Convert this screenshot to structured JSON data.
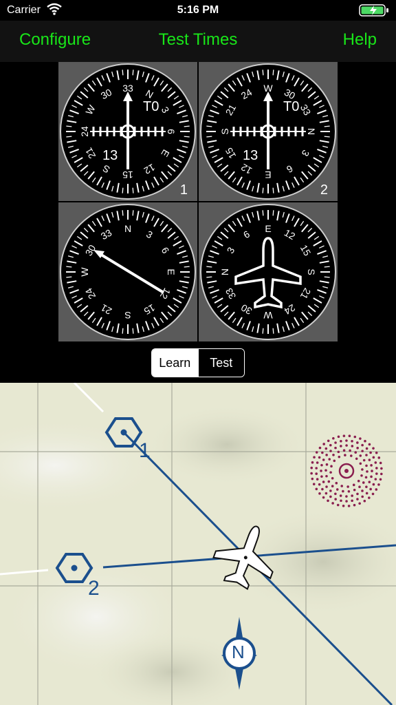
{
  "status": {
    "carrier": "Carrier",
    "time": "5:16 PM"
  },
  "nav": {
    "configure": "Configure",
    "title": "Test Times",
    "help": "Help"
  },
  "instruments": [
    {
      "to_from": "T0",
      "course": "13",
      "number": "1"
    },
    {
      "to_from": "T0",
      "course": "13",
      "number": "2"
    }
  ],
  "segmented": {
    "learn": "Learn",
    "test": "Test",
    "selected": "Learn"
  },
  "map": {
    "vor1_label": "1",
    "vor2_label": "2",
    "north_label": "N"
  },
  "colors": {
    "accent": "#19e619",
    "map_blue": "#1b4f8d",
    "restricted": "#8a1f4f"
  }
}
